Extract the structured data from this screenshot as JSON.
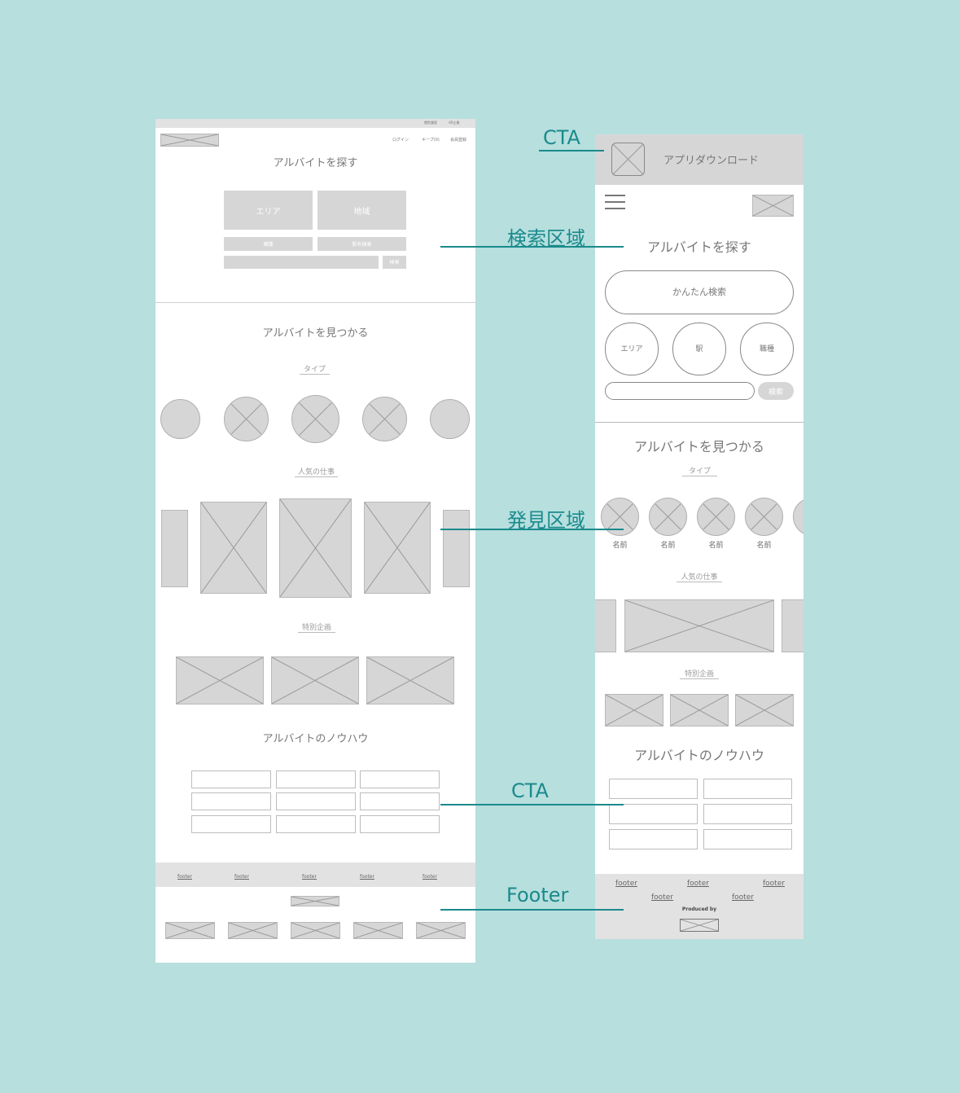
{
  "callouts": {
    "cta_top": "CTA",
    "search": "検索区域",
    "discover": "発見区域",
    "cta_mid": "CTA",
    "footer": "Footer"
  },
  "desktop": {
    "topbar_links": [
      "閲覧履歴",
      "AR企業"
    ],
    "nav": [
      "ログイン",
      "キープ(0)",
      "会員登録"
    ],
    "search_title": "アルバイトを探す",
    "search_buttons": {
      "area": "エリア",
      "region": "地域",
      "job": "職種",
      "detail": "駅名検索",
      "submit": "検索"
    },
    "discover_title": "アルバイトを見つかる",
    "type_label": "タイプ",
    "popular_label": "人気の仕事",
    "special_label": "特別企画",
    "knowhow_title": "アルバイトのノウハウ",
    "footer_links": [
      "footer",
      "footer",
      "footer",
      "footer",
      "footer"
    ]
  },
  "mobile": {
    "app_download": "アプリダウンロード",
    "search_title": "アルバイトを探す",
    "easy_search": "かんたん検索",
    "search_options": [
      "エリア",
      "駅",
      "職種"
    ],
    "submit": "検索",
    "discover_title": "アルバイトを見つかる",
    "type_label": "タイプ",
    "type_names": [
      "名前",
      "名前",
      "名前",
      "名前"
    ],
    "popular_label": "人気の仕事",
    "special_label": "特別企画",
    "knowhow_title": "アルバイトのノウハウ",
    "footer_links_row1": [
      "footer",
      "footer",
      "footer"
    ],
    "footer_links_row2": [
      "footer",
      "footer"
    ],
    "produced_by": "Produced by"
  }
}
